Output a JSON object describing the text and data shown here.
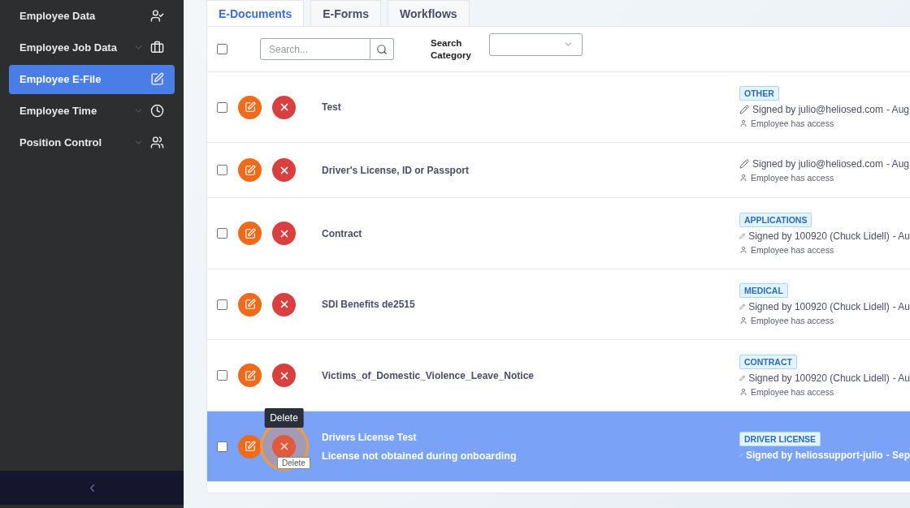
{
  "sidebar": {
    "items": [
      {
        "label": "Employee Data",
        "expandable": false,
        "selected": false
      },
      {
        "label": "Employee Job Data",
        "expandable": true,
        "selected": false
      },
      {
        "label": "Employee E-File",
        "expandable": false,
        "selected": true
      },
      {
        "label": "Employee Time",
        "expandable": true,
        "selected": false
      },
      {
        "label": "Position Control",
        "expandable": true,
        "selected": false
      }
    ]
  },
  "tabs": [
    {
      "label": "E-Documents",
      "selected": true
    },
    {
      "label": "E-Forms",
      "selected": false
    },
    {
      "label": "Workflows",
      "selected": false
    }
  ],
  "toolbar": {
    "select_all_checked": false,
    "search": {
      "placeholder": "Search..."
    },
    "category_label": "Search Category"
  },
  "rows": [
    {
      "title": "Test",
      "tag": "OTHER",
      "signed_by": "Signed by julio@heliosed.com",
      "date": "- Aug",
      "access": "Employee has access",
      "checked": false,
      "selected": false
    },
    {
      "title": "Driver's License, ID or Passport",
      "signed_by": "Signed by julio@heliosed.com",
      "date": "- Aug",
      "access": "Employee has access",
      "checked": false,
      "selected": false
    },
    {
      "title": "Contract",
      "tag": "APPLICATIONS",
      "signed_by": "Signed by  100920 (Chuck Lidell)",
      "date": "- Au",
      "access": "Employee has access",
      "checked": false,
      "selected": false
    },
    {
      "title": "SDI Benefits de2515",
      "tag": "MEDICAL",
      "signed_by": "Signed by  100920 (Chuck Lidell)",
      "date": "- Au",
      "access": "Employee has access",
      "checked": false,
      "selected": false
    },
    {
      "title": "Victims_of_Domestic_Violence_Leave_Notice",
      "tag": "CONTRACT",
      "signed_by": "Signed by  100920 (Chuck Lidell)",
      "date": "- Au",
      "access": "Employee has access",
      "checked": false,
      "selected": false
    },
    {
      "title": "Drivers License Test",
      "subtitle": "License not obtained during onboarding",
      "tag": "DRIVER LICENSE",
      "signed_by": "Signed by heliossupport-julio",
      "date": "- Sep",
      "checked": false,
      "selected": true,
      "tooltip": "Delete",
      "hint": "Delete"
    }
  ]
}
